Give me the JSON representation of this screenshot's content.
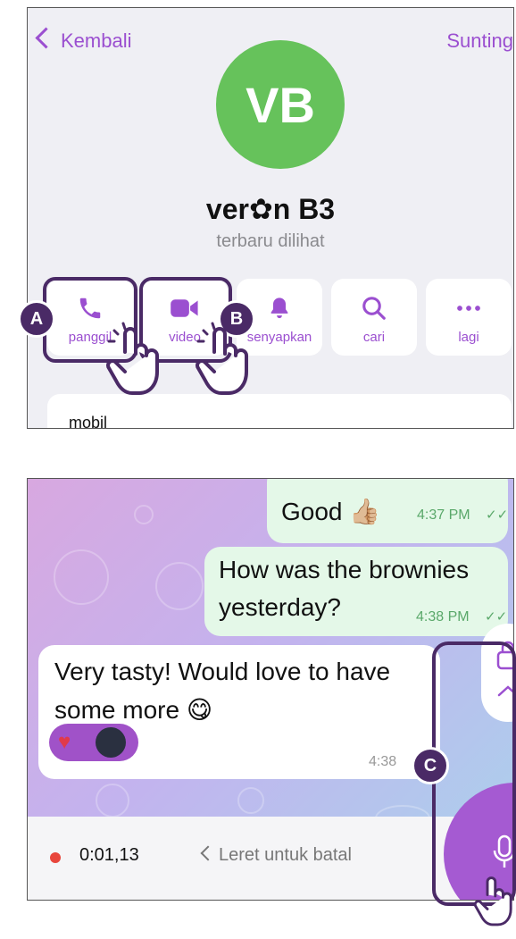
{
  "profile": {
    "back_label": "Kembali",
    "edit_label": "Sunting",
    "avatar_initials": "VB",
    "name": "ver✿n B3",
    "status": "terbaru dilihat",
    "actions": [
      {
        "label": "panggil",
        "icon": "phone-icon"
      },
      {
        "label": "video",
        "icon": "video-camera-icon"
      },
      {
        "label": "senyapkan",
        "icon": "bell-icon"
      },
      {
        "label": "cari",
        "icon": "search-icon"
      },
      {
        "label": "lagi",
        "icon": "more-dots-icon"
      }
    ],
    "info_label": "mobil",
    "accent_color": "#9b4fd0",
    "avatar_color": "#66c25b"
  },
  "annotations": {
    "a": "A",
    "b": "B",
    "c": "C"
  },
  "chat": {
    "messages": [
      {
        "text": "Good 👍🏼",
        "time": "4:37 PM",
        "direction": "out"
      },
      {
        "text_line1": "How was the brownies",
        "text_line2": "yesterday?",
        "time": "4:38 PM",
        "direction": "out"
      },
      {
        "text_line1": "Very tasty! Would love to have",
        "text_line2": "some more 😋",
        "time": "4:38",
        "direction": "in",
        "reactions": [
          "heart",
          "avatar"
        ]
      }
    ],
    "recording_time": "0:01,13",
    "swipe_hint": "Leret untuk batal"
  }
}
